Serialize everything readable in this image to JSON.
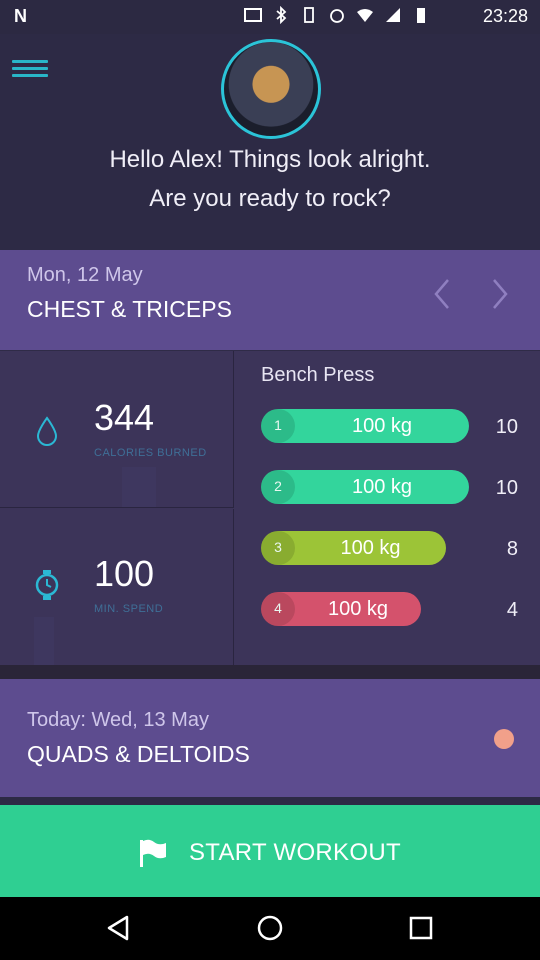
{
  "status_bar": {
    "time": "23:28"
  },
  "header": {
    "greeting_line1": "Hello Alex! Things look alright.",
    "greeting_line2": "Are you ready to rock?"
  },
  "previous_workout": {
    "date": "Mon, 12 May",
    "title": "CHEST & TRICEPS"
  },
  "stats": {
    "calories": {
      "value": "344",
      "label": "CALORIES BURNED"
    },
    "minutes": {
      "value": "100",
      "label": "MIN. SPEND"
    }
  },
  "exercise": {
    "name": "Bench Press",
    "sets": [
      {
        "index": "1",
        "weight": "100 kg",
        "reps": "10",
        "color": "#33d59c",
        "fill": 0.83
      },
      {
        "index": "2",
        "weight": "100 kg",
        "reps": "10",
        "color": "#33d59c",
        "fill": 0.83
      },
      {
        "index": "3",
        "weight": "100 kg",
        "reps": "8",
        "color": "#9cc437",
        "fill": 0.74
      },
      {
        "index": "4",
        "weight": "100 kg",
        "reps": "4",
        "color": "#d4526c",
        "fill": 0.64
      }
    ]
  },
  "today_workout": {
    "date": "Today: Wed, 13 May",
    "title": "QUADS & DELTOIDS"
  },
  "start_button": {
    "label": "START WORKOUT"
  },
  "icons": {
    "menu": "hamburger-icon",
    "calories": "water-drop-icon",
    "time": "stopwatch-icon",
    "start": "flag-icon"
  }
}
